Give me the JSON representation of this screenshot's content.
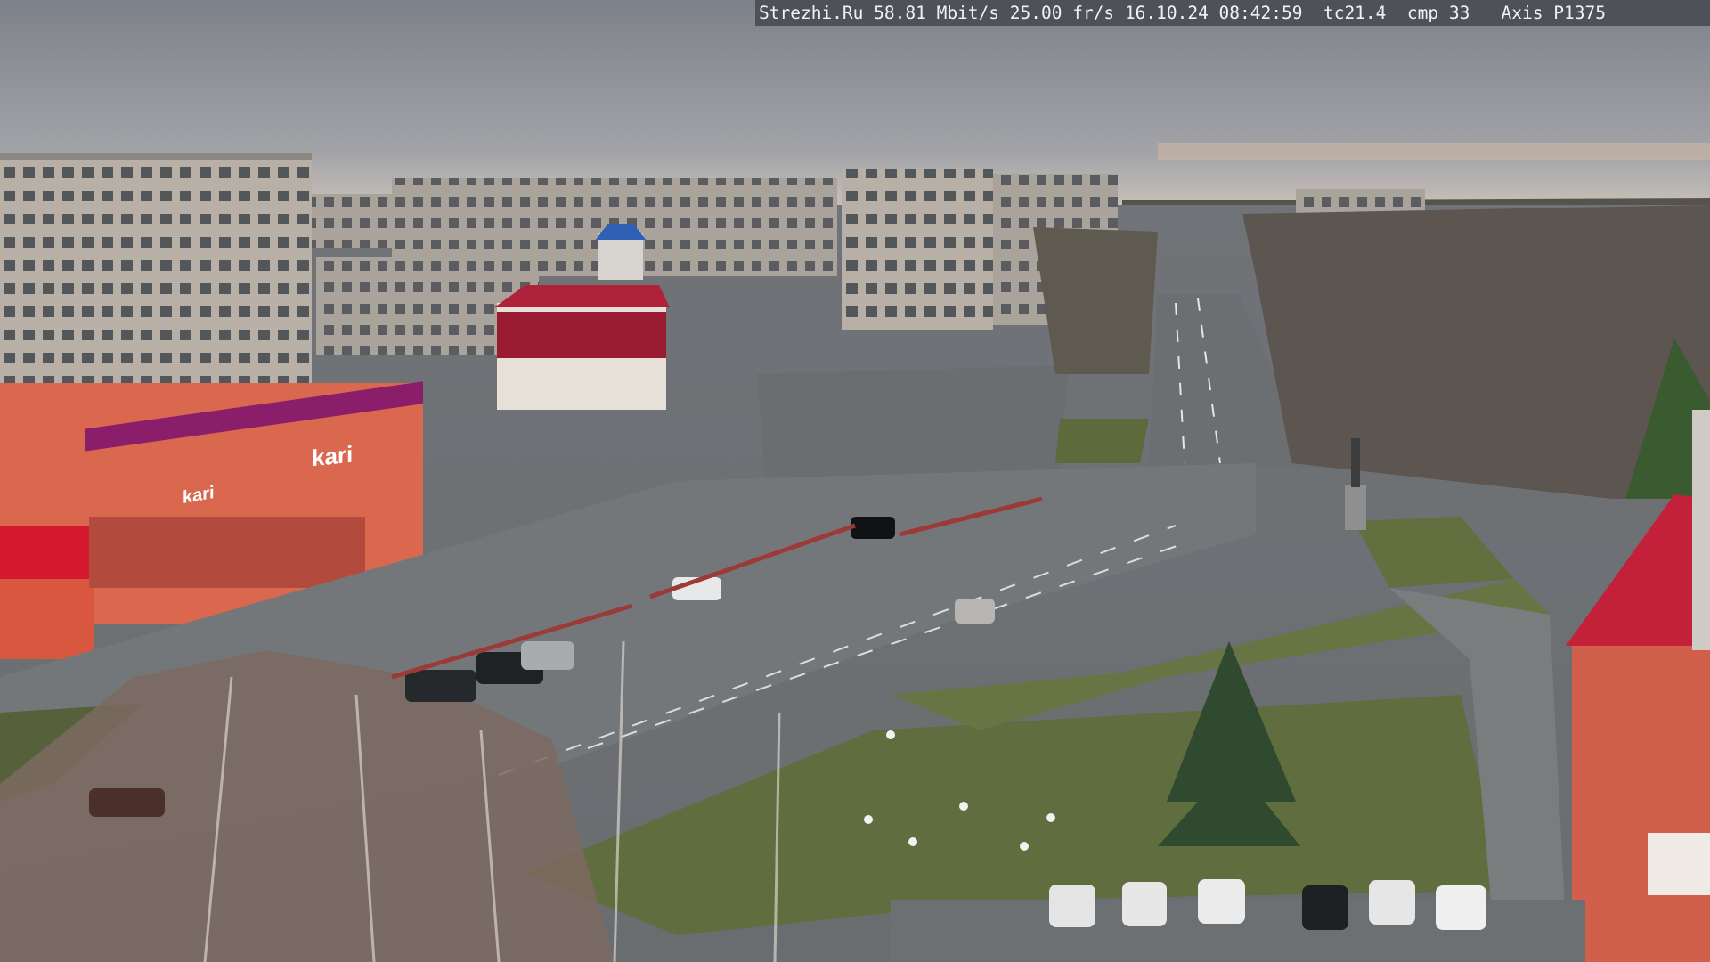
{
  "camera_overlay": {
    "text": "Strezhi.Ru 58.81 Mbit/s 25.00 fr/s 16.10.24 08:42:59  tc21.4  cmp 33   Axis P1375"
  },
  "signs": {
    "store_logo_upper": "kari",
    "store_logo_lower": "kari"
  },
  "colors": {
    "sky_top": "#868a92",
    "sky_horizon": "#c9c3bd",
    "asphalt": "#76797d",
    "grass": "#5f6d3f",
    "store_facade": "#d9684f",
    "store_band": "#8b1e6a",
    "roof_red": "#b0223a"
  }
}
